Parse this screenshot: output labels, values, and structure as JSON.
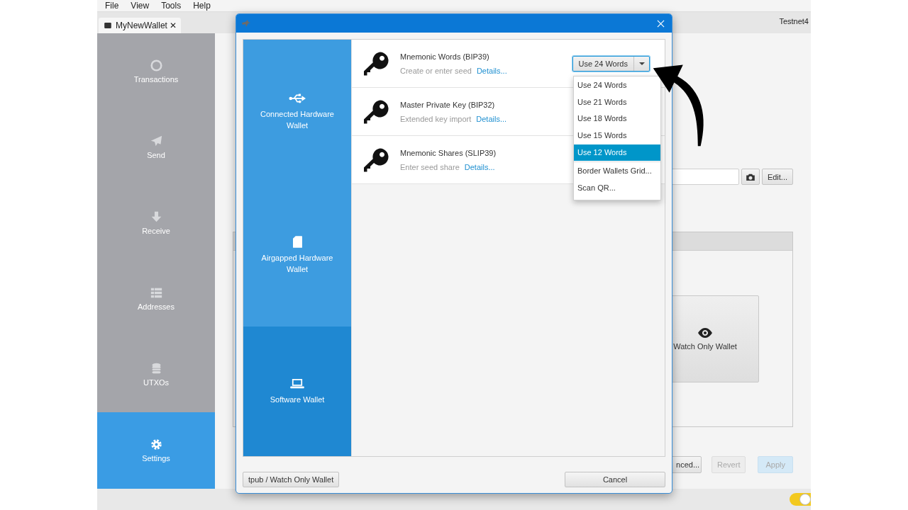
{
  "menu": [
    "File",
    "View",
    "Tools",
    "Help"
  ],
  "tabs": [
    {
      "label": "MyNewWallet",
      "selected": true,
      "close": "✕"
    }
  ],
  "network": "Testnet4",
  "sidebar": {
    "items": [
      {
        "label": "Transactions",
        "selected": false
      },
      {
        "label": "Send",
        "selected": false
      },
      {
        "label": "Receive",
        "selected": false
      },
      {
        "label": "Addresses",
        "selected": false
      },
      {
        "label": "UTXOs",
        "selected": false
      },
      {
        "label": "Settings",
        "selected": true
      }
    ]
  },
  "settings": {
    "edit_button": "Edit...",
    "watch_card": "Watch Only Wallet",
    "buttons": [
      {
        "label": "nced...",
        "disabled": false,
        "kind": "default"
      },
      {
        "label": "Revert",
        "disabled": true,
        "kind": "default"
      },
      {
        "label": "Apply",
        "disabled": true,
        "kind": "primary"
      }
    ],
    "toggle": {
      "on": true
    }
  },
  "dialog": {
    "categories": [
      {
        "label": "Connected Hardware Wallet",
        "selected": false
      },
      {
        "label": "Airgapped Hardware Wallet",
        "selected": false
      },
      {
        "label": "Software Wallet",
        "selected": true
      }
    ],
    "options": [
      {
        "title": "Mnemonic Words (BIP39)",
        "subtitle": "Create or enter seed",
        "link": "Details..."
      },
      {
        "title": "Master Private Key (BIP32)",
        "subtitle": "Extended key import",
        "link": "Details..."
      },
      {
        "title": "Mnemonic Shares (SLIP39)",
        "subtitle": "Enter seed share",
        "link": "Details..."
      }
    ],
    "combo": {
      "value": "Use 24 Words",
      "open": true
    },
    "menu_items": [
      {
        "label": "Use 24 Words",
        "kind": "count",
        "selected": false
      },
      {
        "label": "Use 21 Words",
        "kind": "count",
        "selected": false
      },
      {
        "label": "Use 18 Words",
        "kind": "count",
        "selected": false
      },
      {
        "label": "Use 15 Words",
        "kind": "count",
        "selected": false
      },
      {
        "label": "Use 12 Words",
        "kind": "count",
        "selected": true
      },
      {
        "label": "Border Wallets Grid...",
        "kind": "action",
        "selected": false
      },
      {
        "label": "Scan QR...",
        "kind": "action",
        "selected": false
      }
    ],
    "buttons": [
      "tpub / Watch Only Wallet",
      "Cancel"
    ]
  }
}
